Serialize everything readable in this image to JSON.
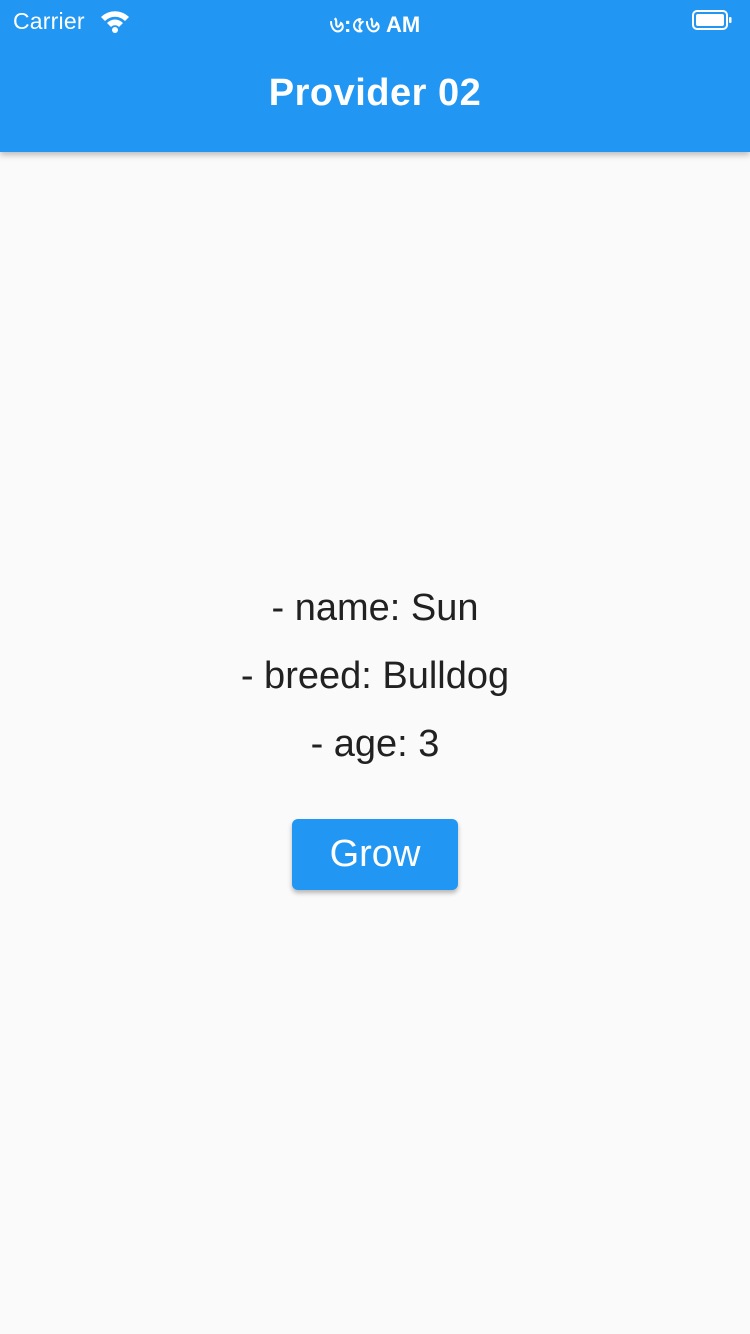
{
  "status_bar": {
    "carrier": "Carrier",
    "time": "৬:৫৬ AM",
    "wifi_icon": "wifi-icon",
    "battery_icon": "battery-icon"
  },
  "app_bar": {
    "title": "Provider 02",
    "color": "#2196F3"
  },
  "dog": {
    "name_line": "- name: Sun",
    "breed_line": "- breed: Bulldog",
    "age_line": "- age: 3"
  },
  "actions": {
    "grow_label": "Grow",
    "button_color": "#2196F3"
  }
}
